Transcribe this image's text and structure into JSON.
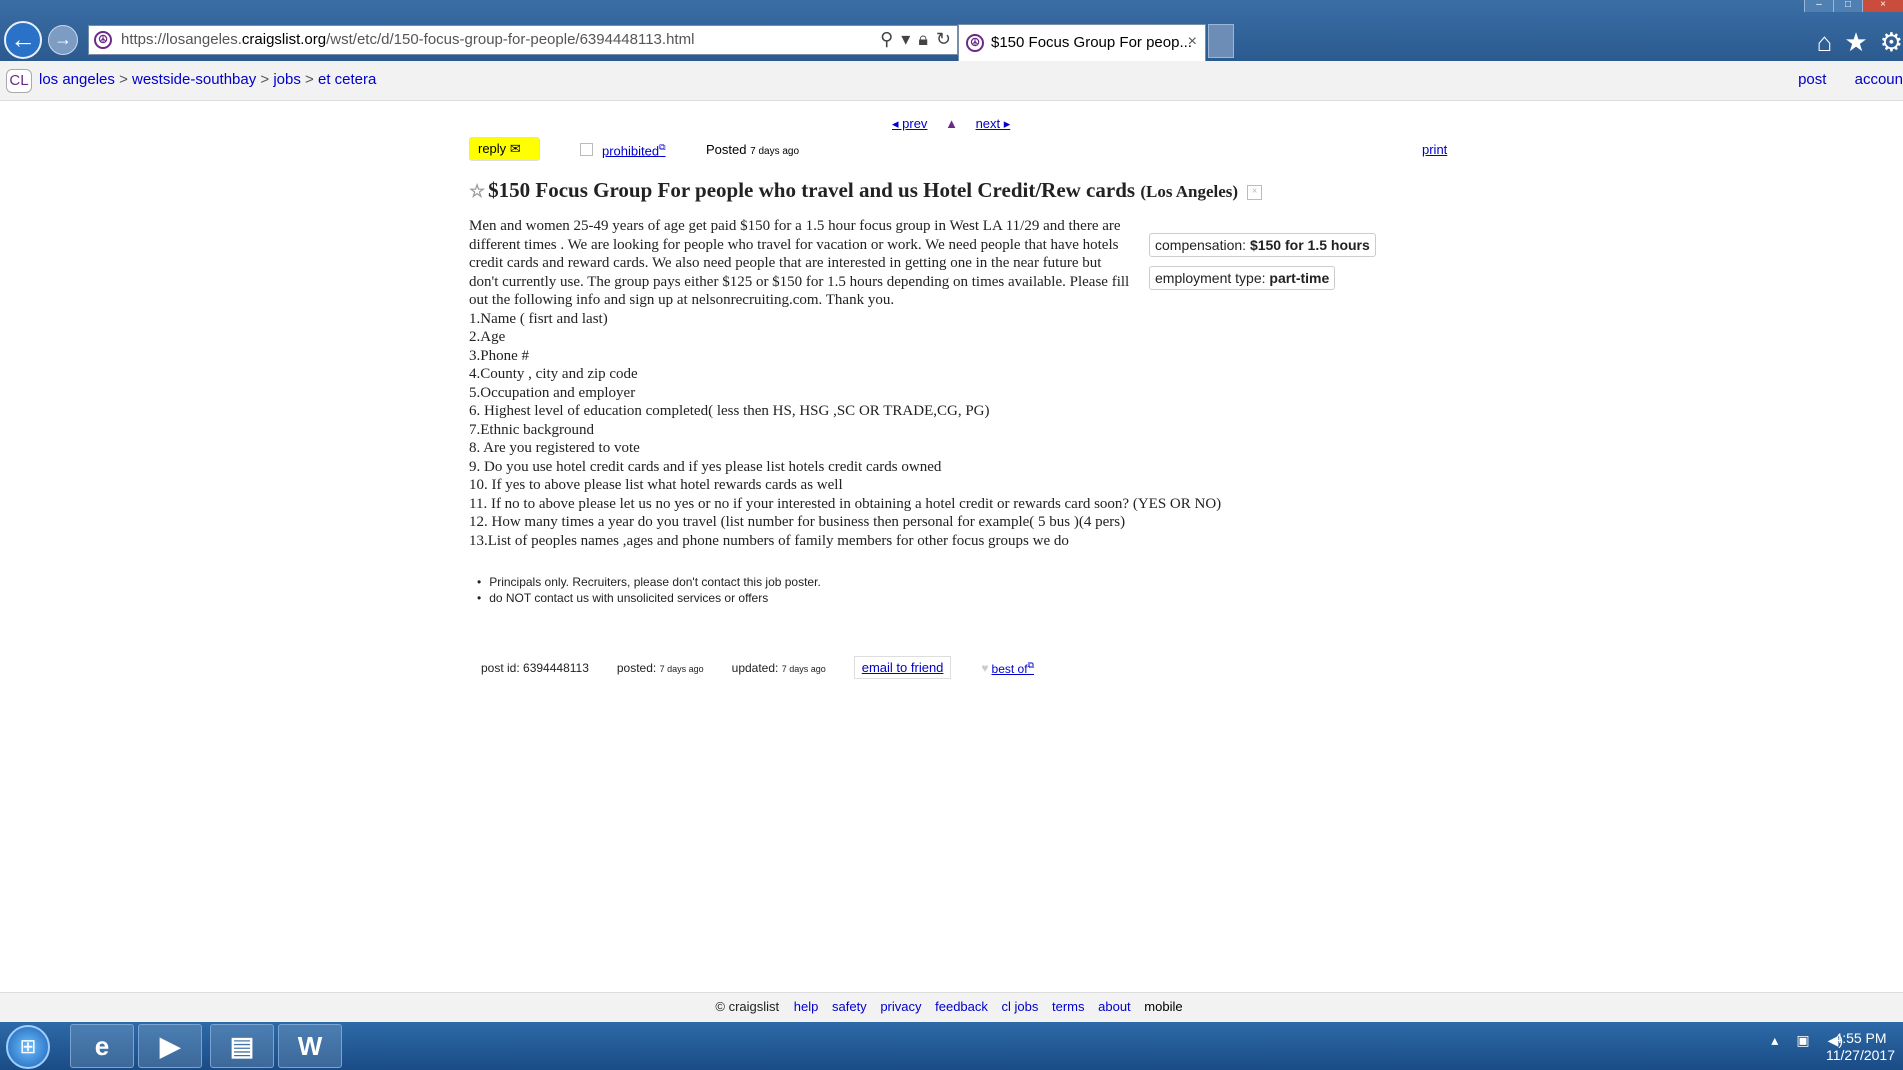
{
  "browser": {
    "url_prefix": "https://losangeles.",
    "url_domain": "craigslist.org",
    "url_path": "/wst/etc/d/150-focus-group-for-people/6394448113.html",
    "tab_title": "$150 Focus Group For peop...",
    "tab_close": "×"
  },
  "header": {
    "logo": "CL",
    "breadcrumbs": [
      "los angeles",
      "westside-southbay",
      "jobs",
      "et cetera"
    ],
    "separator": ">",
    "post_link": "post",
    "account_link": "accoun"
  },
  "posting": {
    "prev": "◂ prev",
    "up": "▲",
    "next": "next ▸",
    "reply": "reply",
    "prohibited": "prohibited",
    "posted_label": "Posted",
    "posted_time": "7 days ago",
    "print": "print",
    "title": "$150 Focus Group For people who travel and us Hotel Credit/Rew cards",
    "location": "(Los Angeles)",
    "attributes": [
      {
        "label": "compensation: ",
        "value": "$150 for 1.5 hours"
      },
      {
        "label": "employment type: ",
        "value": "part-time"
      }
    ],
    "body_intro": "Men and women 25-49 years of age get paid $150 for a 1.5 hour focus group in West LA 11/29 and there are different times . We are looking for people who travel for vacation or work. We need people that have hotels credit cards and reward cards. We also need people that are interested in getting one in the near future but don't currently use. The group pays either $125 or $150 for 1.5 hours depending on times available. Please fill out the following info and sign up at nelsonrecruiting.com. Thank you.",
    "body_lines": [
      "1.Name ( fisrt and last)",
      "2.Age",
      "3.Phone #",
      "4.County , city and zip code",
      "5.Occupation and employer",
      "6. Highest level of education completed( less then HS, HSG ,SC OR TRADE,CG, PG)",
      "7.Ethnic background",
      "8. Are you registered to vote",
      "9. Do you use hotel credit cards and if yes please list hotels credit cards owned",
      "10. If yes to above please list what hotel rewards cards as well",
      "11. If no to above please let us no yes or no if your interested in obtaining a hotel credit or rewards card soon? (YES OR NO)",
      "12. How many times a year do you travel (list number for business then personal for example( 5 bus )(4 pers)",
      "13.List of peoples names ,ages and phone numbers of family members for other focus groups we do"
    ],
    "notices": [
      "Principals only. Recruiters, please don't contact this job poster.",
      "do NOT contact us with unsolicited services or offers"
    ],
    "post_id": "post id: 6394448113",
    "posted_label2": "posted:",
    "posted_time2": "7 days ago",
    "updated_label": "updated:",
    "updated_time": "7 days ago",
    "email_friend": "email to friend",
    "best_of": "best of"
  },
  "footer": {
    "copyright": "© craigslist",
    "links": [
      "help",
      "safety",
      "privacy",
      "feedback",
      "cl jobs",
      "terms",
      "about",
      "mobile"
    ]
  },
  "taskbar": {
    "time": "4:55 PM",
    "date": "11/27/2017",
    "word_icon": "W"
  }
}
